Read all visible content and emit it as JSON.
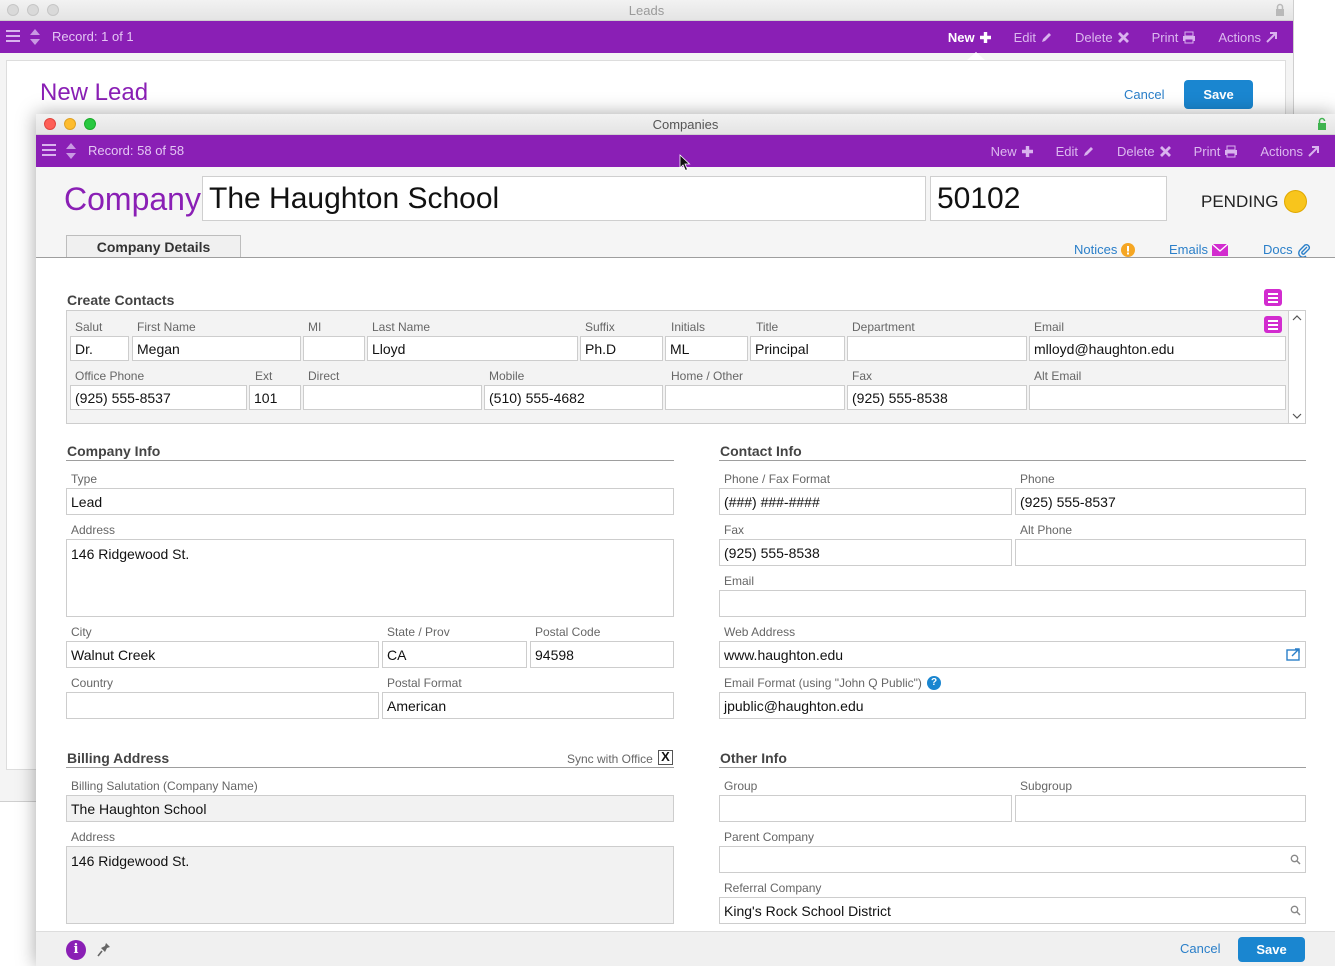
{
  "leads": {
    "window_title": "Leads",
    "record": "Record: 1 of 1",
    "toolbar": {
      "new": "New",
      "edit": "Edit",
      "delete": "Delete",
      "print": "Print",
      "actions": "Actions"
    },
    "title": "New Lead",
    "cancel": "Cancel",
    "save": "Save"
  },
  "companies": {
    "window_title": "Companies",
    "record": "Record: 58 of 58",
    "toolbar": {
      "new": "New",
      "edit": "Edit",
      "delete": "Delete",
      "print": "Print",
      "actions": "Actions"
    },
    "company_label": "Company:",
    "company_name": "The Haughton School",
    "company_id": "50102",
    "status": "PENDING",
    "status_color": "#f8c51c",
    "tab": "Company Details",
    "links": {
      "notices": "Notices",
      "emails": "Emails",
      "docs": "Docs"
    }
  },
  "contacts": {
    "title": "Create Contacts",
    "row1_labels": {
      "salut": "Salut",
      "first": "First Name",
      "mi": "MI",
      "last": "Last Name",
      "suffix": "Suffix",
      "initials": "Initials",
      "title": "Title",
      "department": "Department",
      "email": "Email"
    },
    "row1_values": {
      "salut": "Dr.",
      "first": "Megan",
      "mi": "",
      "last": "Lloyd",
      "suffix": "Ph.D",
      "initials": "ML",
      "title": "Principal",
      "department": "",
      "email": "mlloyd@haughton.edu"
    },
    "row2_labels": {
      "office": "Office Phone",
      "ext": "Ext",
      "direct": "Direct",
      "mobile": "Mobile",
      "home": "Home / Other",
      "fax": "Fax",
      "alt_email": "Alt Email"
    },
    "row2_values": {
      "office": "(925) 555-8537",
      "ext": "101",
      "direct": "",
      "mobile": "(510) 555-4682",
      "home": "",
      "fax": "(925) 555-8538",
      "alt_email": ""
    }
  },
  "company_info": {
    "title": "Company Info",
    "type_label": "Type",
    "type": "Lead",
    "address_label": "Address",
    "address": "146 Ridgewood St.",
    "city_label": "City",
    "city": "Walnut Creek",
    "state_label": "State / Prov",
    "state": "CA",
    "postal_label": "Postal Code",
    "postal": "94598",
    "country_label": "Country",
    "country": "",
    "postal_format_label": "Postal Format",
    "postal_format": "American"
  },
  "contact_info": {
    "title": "Contact Info",
    "phone_format_label": "Phone / Fax Format",
    "phone_format": "(###) ###-####",
    "phone_label": "Phone",
    "phone": "(925) 555-8537",
    "fax_label": "Fax",
    "fax": "(925) 555-8538",
    "alt_phone_label": "Alt Phone",
    "alt_phone": "",
    "email_label": "Email",
    "email": "",
    "web_label": "Web Address",
    "web": "www.haughton.edu",
    "email_format_label": "Email Format (using \"John Q Public\")",
    "email_format": "jpublic@haughton.edu"
  },
  "billing": {
    "title": "Billing Address",
    "sync_label": "Sync with Office",
    "sync_checked": "X",
    "salutation_label": "Billing Salutation (Company Name)",
    "salutation": "The Haughton School",
    "address_label": "Address",
    "address": "146 Ridgewood St."
  },
  "other_info": {
    "title": "Other Info",
    "group_label": "Group",
    "group": "",
    "subgroup_label": "Subgroup",
    "subgroup": "",
    "parent_label": "Parent Company",
    "parent": "",
    "referral_label": "Referral Company",
    "referral": "King's Rock School District"
  },
  "footer": {
    "cancel": "Cancel",
    "save": "Save"
  },
  "colors": {
    "accent": "#8a1fb5",
    "link": "#2a7fc9",
    "save": "#1a86d0",
    "list_icon": "#d22ccf"
  }
}
